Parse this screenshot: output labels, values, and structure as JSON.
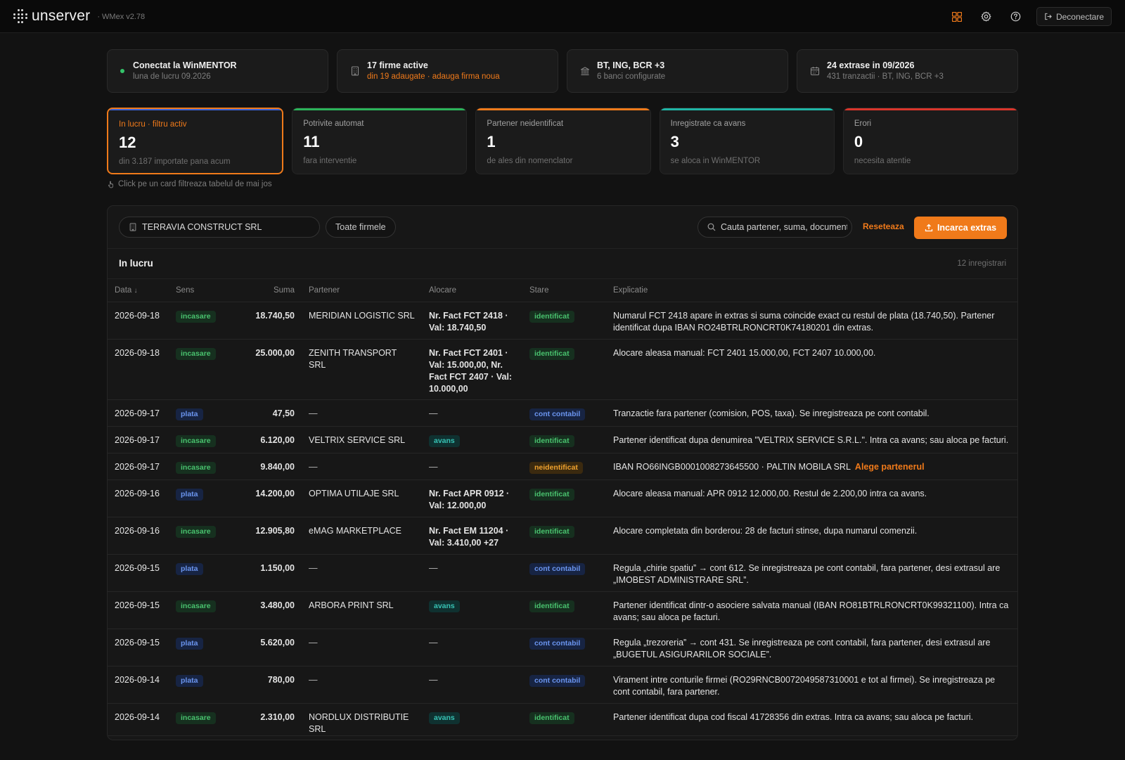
{
  "app": {
    "brand": "unserver",
    "version": "· WMex v2.78"
  },
  "header": {
    "logout_label": "Deconectare"
  },
  "colors": {
    "accent": "#f07a1a",
    "green": "#34c46a",
    "teal": "#1fb5a6",
    "red": "#d9352b",
    "blue": "#3b63d8"
  },
  "status_cards": [
    {
      "title": "Conectat la WinMENTOR",
      "sub": "luna de lucru 09.2026",
      "icon": "connected-dot-icon"
    },
    {
      "title": "17 firme active",
      "sub": "din 19 adaugate · adauga firma noua",
      "icon": "building-icon"
    },
    {
      "title": "BT, ING, BCR +3",
      "sub": "6 banci configurate",
      "icon": "bank-icon"
    },
    {
      "title": "24 extrase in 09/2026",
      "sub": "431 tranzactii · BT, ING, BCR +3",
      "icon": "calendar-icon"
    }
  ],
  "metrics": [
    {
      "label": "In lucru · filtru activ",
      "value": "12",
      "sub": "din 3.187 importate pana acum"
    },
    {
      "label": "Potrivite automat",
      "value": "11",
      "sub": "fara interventie"
    },
    {
      "label": "Partener neidentificat",
      "value": "1",
      "sub": "de ales din nomenclator"
    },
    {
      "label": "Inregistrate ca avans",
      "value": "3",
      "sub": "se aloca in WinMENTOR"
    },
    {
      "label": "Erori",
      "value": "0",
      "sub": "necesita atentie"
    }
  ],
  "hint": "Click pe un card filtreaza tabelul de mai jos",
  "toolbar": {
    "firm": "TERRAVIA CONSTRUCT SRL",
    "all_firms": "Toate firmele",
    "search_placeholder": "Cauta partener, suma, document",
    "reset": "Reseteaza",
    "upload": "Incarca extras"
  },
  "section": {
    "title": "In lucru",
    "count": "12 inregistrari"
  },
  "table": {
    "columns": [
      "Data",
      "Sens",
      "Suma",
      "Partener",
      "Alocare",
      "Stare",
      "Explicatie"
    ],
    "rows": [
      {
        "date": "2026-09-18",
        "dir": "incasare",
        "amount": "18.740,50",
        "partner": "MERIDIAN LOGISTIC SRL",
        "alloc": "Nr. Fact FCT 2418 · Val: 18.740,50",
        "status": "identificat",
        "expl": "Numarul FCT 2418 apare in extras si suma coincide exact cu restul de plata (18.740,50). Partener identificat dupa IBAN RO24BTRLRONCRT0K74180201 din extras."
      },
      {
        "date": "2026-09-18",
        "dir": "incasare",
        "amount": "25.000,00",
        "partner": "ZENITH TRANSPORT SRL",
        "alloc": "Nr. Fact FCT 2401 · Val: 15.000,00, Nr. Fact FCT 2407 · Val: 10.000,00",
        "status": "identificat",
        "expl": "Alocare aleasa manual: FCT 2401 15.000,00, FCT 2407 10.000,00."
      },
      {
        "date": "2026-09-17",
        "dir": "plata",
        "amount": "47,50",
        "partner": "—",
        "alloc": "—",
        "status": "cont contabil",
        "expl": "Tranzactie fara partener (comision, POS, taxa). Se inregistreaza pe cont contabil."
      },
      {
        "date": "2026-09-17",
        "dir": "incasare",
        "amount": "6.120,00",
        "partner": "VELTRIX SERVICE SRL",
        "alloc": "avans",
        "status": "identificat",
        "expl": "Partener identificat dupa denumirea \"VELTRIX SERVICE S.R.L.\". Intra ca avans; sau aloca pe facturi."
      },
      {
        "date": "2026-09-17",
        "dir": "incasare",
        "amount": "9.840,00",
        "partner": "—",
        "alloc": "—",
        "status": "neidentificat",
        "expl": "IBAN RO66INGB0001008273645500 · PALTIN MOBILA SRL",
        "action": "Alege partenerul"
      },
      {
        "date": "2026-09-16",
        "dir": "plata",
        "amount": "14.200,00",
        "partner": "OPTIMA UTILAJE SRL",
        "alloc": "Nr. Fact APR 0912 · Val: 12.000,00",
        "status": "identificat",
        "expl": "Alocare aleasa manual: APR 0912 12.000,00. Restul de 2.200,00 intra ca avans."
      },
      {
        "date": "2026-09-16",
        "dir": "incasare",
        "amount": "12.905,80",
        "partner": "eMAG MARKETPLACE",
        "alloc": "Nr. Fact EM 11204 · Val: 3.410,00 +27",
        "status": "identificat",
        "expl": "Alocare completata din borderou: 28 de facturi stinse, dupa numarul comenzii."
      },
      {
        "date": "2026-09-15",
        "dir": "plata",
        "amount": "1.150,00",
        "partner": "—",
        "alloc": "—",
        "status": "cont contabil",
        "expl": "Regula „chirie spatiu” → cont 612. Se inregistreaza pe cont contabil, fara partener, desi extrasul are „IMOBEST ADMINISTRARE SRL”."
      },
      {
        "date": "2026-09-15",
        "dir": "incasare",
        "amount": "3.480,00",
        "partner": "ARBORA PRINT SRL",
        "alloc": "avans",
        "status": "identificat",
        "expl": "Partener identificat dintr-o asociere salvata manual (IBAN RO81BTRLRONCRT0K99321100). Intra ca avans; sau aloca pe facturi."
      },
      {
        "date": "2026-09-15",
        "dir": "plata",
        "amount": "5.620,00",
        "partner": "—",
        "alloc": "—",
        "status": "cont contabil",
        "expl": "Regula „trezoreria” → cont 431. Se inregistreaza pe cont contabil, fara partener, desi extrasul are „BUGETUL ASIGURARILOR SOCIALE”."
      },
      {
        "date": "2026-09-14",
        "dir": "plata",
        "amount": "780,00",
        "partner": "—",
        "alloc": "—",
        "status": "cont contabil",
        "expl": "Virament intre conturile firmei (RO29RNCB0072049587310001 e tot al firmei). Se inregistreaza pe cont contabil, fara partener."
      },
      {
        "date": "2026-09-14",
        "dir": "incasare",
        "amount": "2.310,00",
        "partner": "NORDLUX DISTRIBUTIE SRL",
        "alloc": "avans",
        "status": "identificat",
        "expl": "Partener identificat dupa cod fiscal 41728356 din extras. Intra ca avans; sau aloca pe facturi."
      }
    ]
  }
}
